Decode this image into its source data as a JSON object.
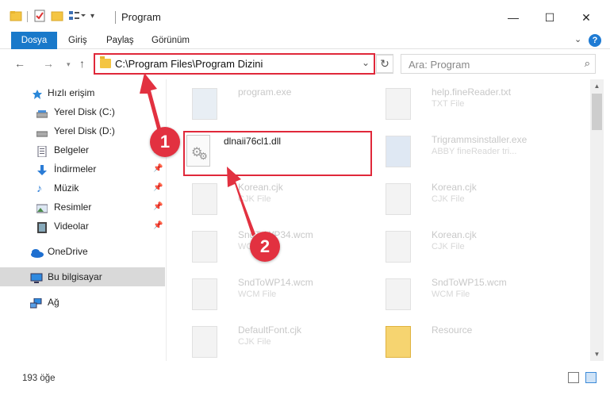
{
  "window": {
    "title": "Program",
    "minimize": "—",
    "maximize": "☐",
    "close": "✕"
  },
  "ribbon": {
    "tabs": [
      "Dosya",
      "Giriş",
      "Paylaş",
      "Görünüm"
    ]
  },
  "address": {
    "path": "C:\\Program Files\\Program Dizini",
    "search_placeholder": "Ara: Program"
  },
  "sidebar": {
    "items": [
      {
        "label": "Hızlı erişim",
        "icon": "star-icon"
      },
      {
        "label": "Yerel Disk (C:)",
        "icon": "drive-icon"
      },
      {
        "label": "Yerel Disk (D:)",
        "icon": "drive-icon"
      },
      {
        "label": "Belgeler",
        "icon": "documents-icon"
      },
      {
        "label": "İndirmeler",
        "icon": "download-icon"
      },
      {
        "label": "Müzik",
        "icon": "music-icon"
      },
      {
        "label": "Resimler",
        "icon": "pictures-icon"
      },
      {
        "label": "Videolar",
        "icon": "videos-icon"
      },
      {
        "label": "OneDrive",
        "icon": "cloud-icon"
      },
      {
        "label": "Bu bilgisayar",
        "icon": "computer-icon"
      },
      {
        "label": "Ağ",
        "icon": "network-icon"
      }
    ]
  },
  "files": {
    "left": [
      {
        "name": "program.exe",
        "type": ""
      },
      {
        "name": "dlnaii76cl1.dll",
        "type": ""
      },
      {
        "name": "Korean.cjk",
        "type": "CJK File"
      },
      {
        "name": "SndToWP34.wcm",
        "type": "WCM File"
      },
      {
        "name": "SndToWP14.wcm",
        "type": "WCM File"
      },
      {
        "name": "DefaultFont.cjk",
        "type": "CJK File"
      }
    ],
    "right": [
      {
        "name": "help.fineReader.txt",
        "type": "TXT File"
      },
      {
        "name": "Trigrammsinstaller.exe",
        "type": "ABBY fineReader tri..."
      },
      {
        "name": "Korean.cjk",
        "type": "CJK File"
      },
      {
        "name": "Korean.cjk",
        "type": "CJK File"
      },
      {
        "name": "SndToWP15.wcm",
        "type": "WCM File"
      },
      {
        "name": "Resource",
        "type": ""
      }
    ]
  },
  "callouts": [
    "1",
    "2"
  ],
  "status": {
    "count": "193 öğe"
  },
  "colors": {
    "accent": "#1979ca",
    "highlight": "#e0283a"
  }
}
